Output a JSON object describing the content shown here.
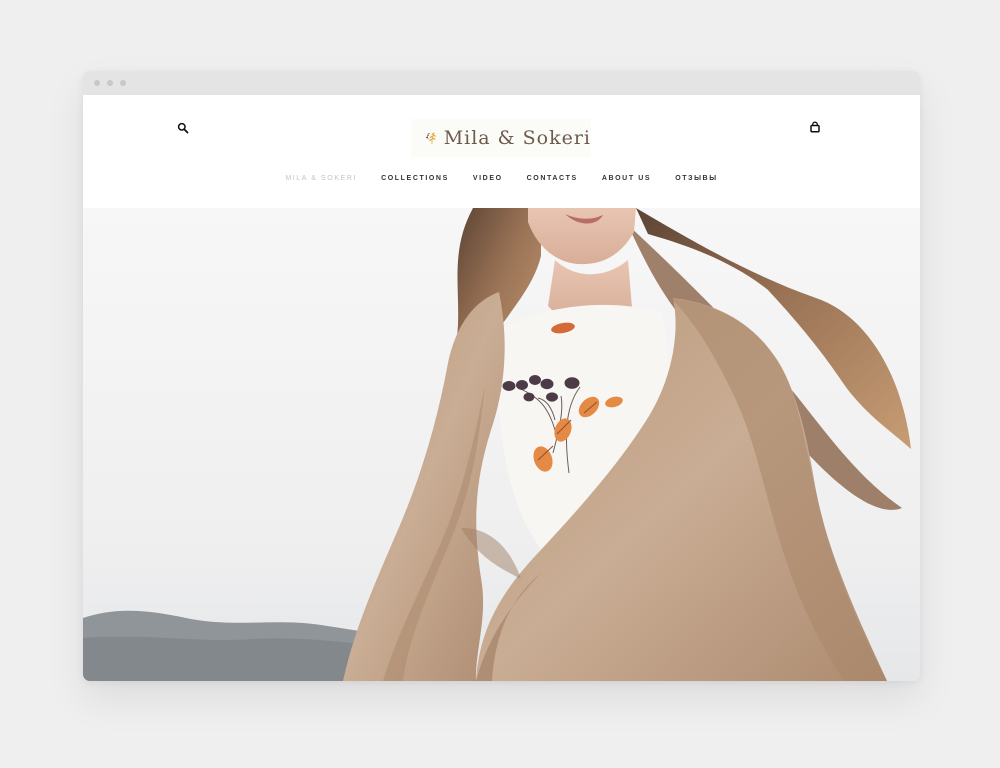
{
  "brand": {
    "name": "Mila & Sokeri"
  },
  "header": {
    "search_icon": "search-icon",
    "cart_icon": "shopping-bag-icon",
    "logo_icon": "wheat-sprig-icon"
  },
  "navigation": {
    "items": [
      {
        "label": "MILA & SOKERI",
        "active": true
      },
      {
        "label": "COLLECTIONS",
        "active": false
      },
      {
        "label": "VIDEO",
        "active": false
      },
      {
        "label": "CONTACTS",
        "active": false
      },
      {
        "label": "ABOUT US",
        "active": false
      },
      {
        "label": "ОТЗЫВЫ",
        "active": false
      }
    ]
  },
  "colors": {
    "page_background": "#efefef",
    "browser_chrome": "#e4e4e4",
    "nav_text": "#333333",
    "nav_active_text": "#c4c4c4",
    "logo_brown": "#6d5a4d",
    "logo_gold": "#e0b24a",
    "shawl": "#c7a98f",
    "hair": "#8b654b"
  }
}
